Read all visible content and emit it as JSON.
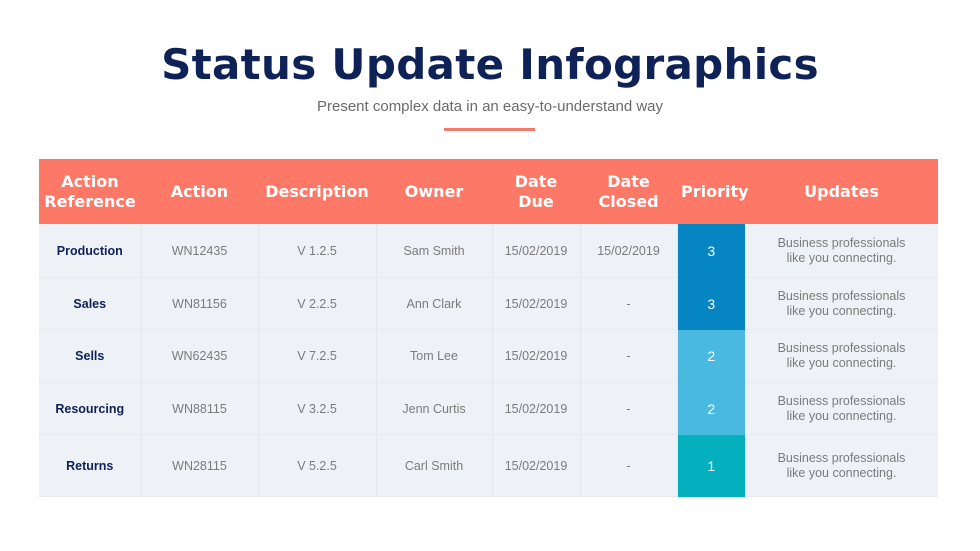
{
  "header": {
    "title": "Status Update Infographics",
    "subtitle": "Present complex data in an easy-to-understand way"
  },
  "colors": {
    "title": "#0e2257",
    "header_bg": "#fd7867",
    "accent_line": "#f07a6b",
    "row_bg": "#eef1f6",
    "priority_3": "#0585c1",
    "priority_2": "#4ab9e0",
    "priority_1": "#04b0be"
  },
  "table": {
    "columns": [
      {
        "line1": "Action",
        "line2": "Reference"
      },
      {
        "line1": "Action",
        "line2": ""
      },
      {
        "line1": "Description",
        "line2": ""
      },
      {
        "line1": "Owner",
        "line2": ""
      },
      {
        "line1": "Date Due",
        "line2": ""
      },
      {
        "line1": "Date",
        "line2": "Closed"
      },
      {
        "line1": "Priority",
        "line2": ""
      },
      {
        "line1": "Updates",
        "line2": ""
      }
    ],
    "rows": [
      {
        "reference": "Production",
        "action": "WN12435",
        "description": "V 1.2.5",
        "owner": "Sam Smith",
        "date_due": "15/02/2019",
        "date_closed": "15/02/2019",
        "priority": "3",
        "updates_line1": "Business professionals",
        "updates_line2": "like you connecting."
      },
      {
        "reference": "Sales",
        "action": "WN81156",
        "description": "V 2.2.5",
        "owner": "Ann Clark",
        "date_due": "15/02/2019",
        "date_closed": "-",
        "priority": "3",
        "updates_line1": "Business professionals",
        "updates_line2": "like you connecting."
      },
      {
        "reference": "Sells",
        "action": "WN62435",
        "description": "V 7.2.5",
        "owner": "Tom Lee",
        "date_due": "15/02/2019",
        "date_closed": "-",
        "priority": "2",
        "updates_line1": "Business professionals",
        "updates_line2": "like you connecting."
      },
      {
        "reference": "Resourcing",
        "action": "WN88115",
        "description": "V 3.2.5",
        "owner": "Jenn Curtis",
        "date_due": "15/02/2019",
        "date_closed": "-",
        "priority": "2",
        "updates_line1": "Business professionals",
        "updates_line2": "like you connecting."
      },
      {
        "reference": "Returns",
        "action": "WN28115",
        "description": "V 5.2.5",
        "owner": "Carl Smith",
        "date_due": "15/02/2019",
        "date_closed": "-",
        "priority": "1",
        "updates_line1": "Business professionals",
        "updates_line2": "like you connecting."
      }
    ]
  }
}
